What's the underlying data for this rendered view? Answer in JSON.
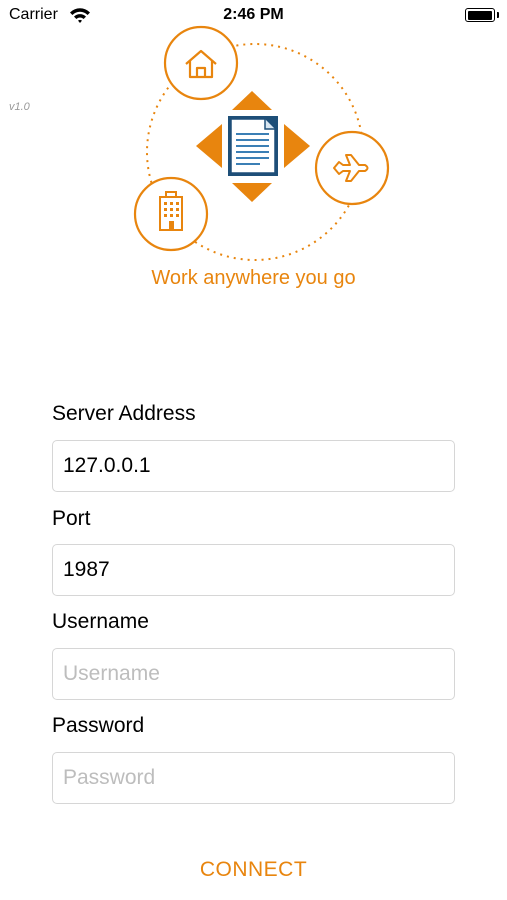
{
  "status_bar": {
    "carrier": "Carrier",
    "time": "2:46 PM"
  },
  "version": "v1.0",
  "hero": {
    "tagline": "Work anywhere you go",
    "accent_color": "#E8850E",
    "icons": [
      "home-icon",
      "building-icon",
      "airplane-icon",
      "document-icon"
    ]
  },
  "form": {
    "server_address": {
      "label": "Server Address",
      "value": "127.0.0.1",
      "placeholder": ""
    },
    "port": {
      "label": "Port",
      "value": "1987",
      "placeholder": ""
    },
    "username": {
      "label": "Username",
      "value": "",
      "placeholder": "Username"
    },
    "password": {
      "label": "Password",
      "value": "",
      "placeholder": "Password"
    }
  },
  "connect_label": "CONNECT"
}
